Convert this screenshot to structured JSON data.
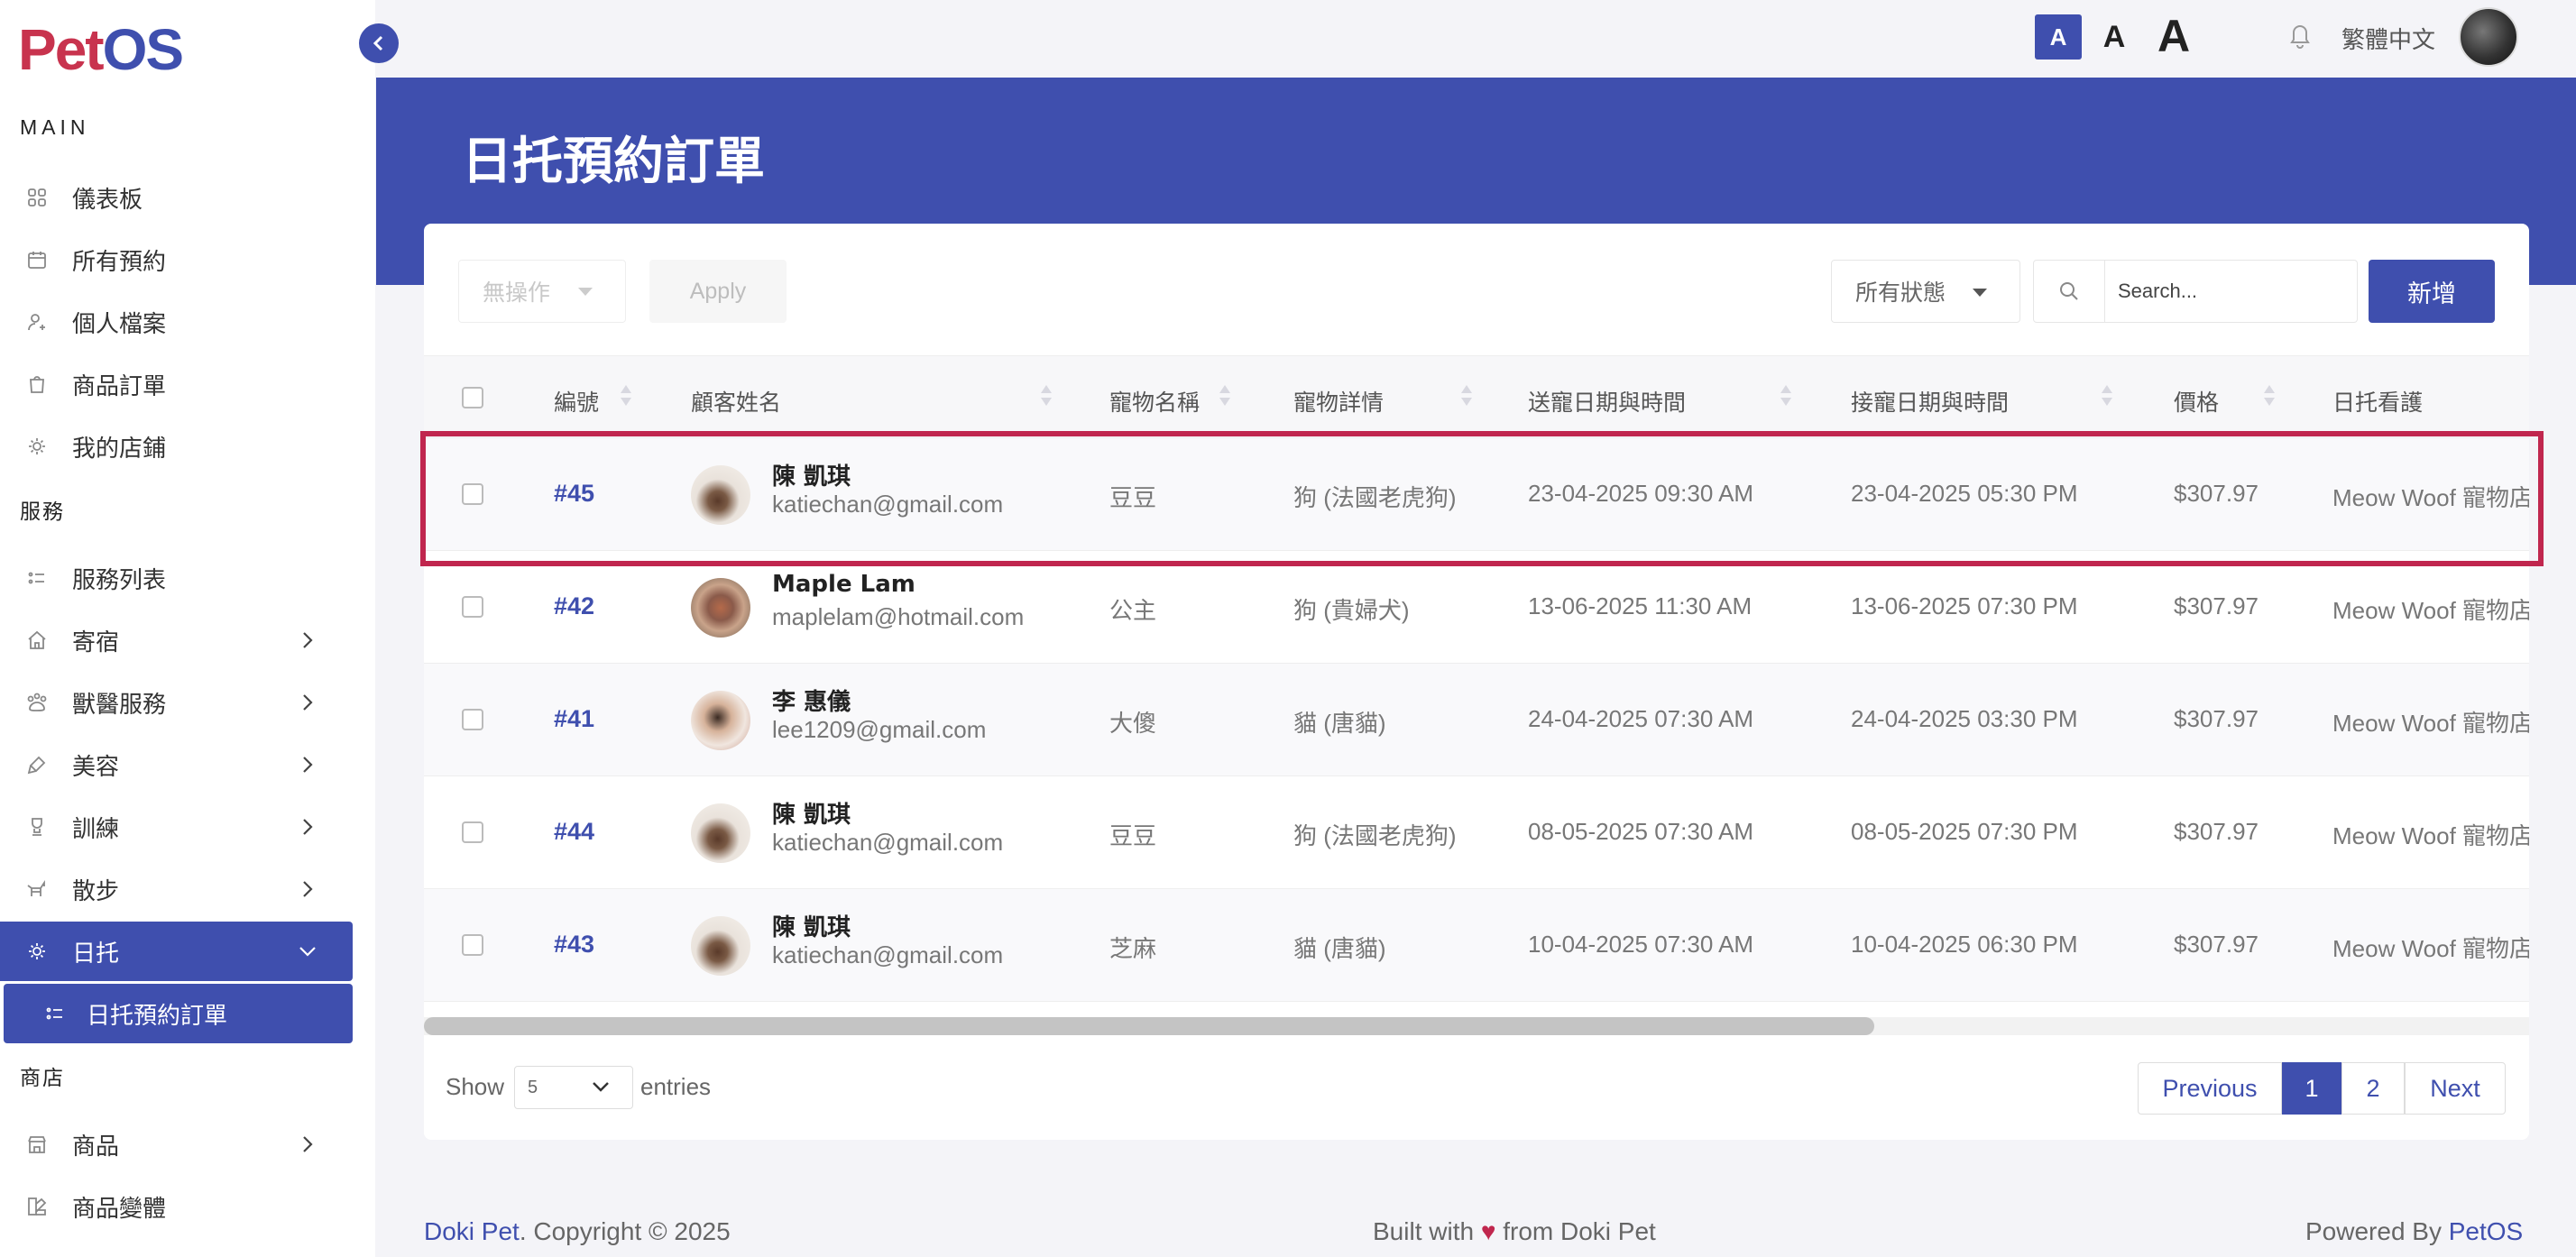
{
  "app": {
    "logo_part1": "Pet",
    "logo_part2": "OS"
  },
  "topbar": {
    "font_small": "A",
    "font_medium": "A",
    "font_large": "A",
    "language": "繁體中文"
  },
  "sidebar": {
    "section_main": "MAIN",
    "main_items": [
      {
        "label": "儀表板",
        "icon": "dashboard-icon"
      },
      {
        "label": "所有預約",
        "icon": "calendar-icon"
      },
      {
        "label": "個人檔案",
        "icon": "user-icon"
      },
      {
        "label": "商品訂單",
        "icon": "shopping-bag-icon"
      },
      {
        "label": "我的店鋪",
        "icon": "store-icon"
      }
    ],
    "section_services": "服務",
    "service_items": [
      {
        "label": "服務列表",
        "icon": "list-icon"
      },
      {
        "label": "寄宿",
        "icon": "house-icon"
      },
      {
        "label": "獸醫服務",
        "icon": "vet-icon"
      },
      {
        "label": "美容",
        "icon": "brush-icon"
      },
      {
        "label": "訓練",
        "icon": "training-icon"
      },
      {
        "label": "散步",
        "icon": "walk-icon"
      },
      {
        "label": "日托",
        "icon": "daycare-icon"
      }
    ],
    "sub_item": "日托預約訂單",
    "section_shop": "商店",
    "shop_items": [
      {
        "label": "商品",
        "icon": "product-icon"
      },
      {
        "label": "商品變體",
        "icon": "variant-icon"
      }
    ]
  },
  "page": {
    "title": "日托預約訂單"
  },
  "toolbar": {
    "bulk_action": "無操作",
    "apply_label": "Apply",
    "status_filter": "所有狀態",
    "search_placeholder": "Search...",
    "add_label": "新增"
  },
  "table": {
    "headers": [
      "編號",
      "顧客姓名",
      "寵物名稱",
      "寵物詳情",
      "送寵日期與時間",
      "接寵日期與時間",
      "價格",
      "日托看護"
    ],
    "rows": [
      {
        "id": "#45",
        "name": "陳 凱琪",
        "email": "katiechan@gmail.com",
        "pet": "豆豆",
        "detail": "狗 (法國老虎狗)",
        "dropoff": "23-04-2025 09:30 AM",
        "pickup": "23-04-2025 05:30 PM",
        "price": "$307.97",
        "caretaker": "Meow Woof 寵物店"
      },
      {
        "id": "#42",
        "name": "Maple Lam",
        "email": "maplelam@hotmail.com",
        "pet": "公主",
        "detail": "狗 (貴婦犬)",
        "dropoff": "13-06-2025 11:30 AM",
        "pickup": "13-06-2025 07:30 PM",
        "price": "$307.97",
        "caretaker": "Meow Woof 寵物店"
      },
      {
        "id": "#41",
        "name": "李 惠儀",
        "email": "lee1209@gmail.com",
        "pet": "大傻",
        "detail": "貓 (唐貓)",
        "dropoff": "24-04-2025 07:30 AM",
        "pickup": "24-04-2025 03:30 PM",
        "price": "$307.97",
        "caretaker": "Meow Woof 寵物店"
      },
      {
        "id": "#44",
        "name": "陳 凱琪",
        "email": "katiechan@gmail.com",
        "pet": "豆豆",
        "detail": "狗 (法國老虎狗)",
        "dropoff": "08-05-2025 07:30 AM",
        "pickup": "08-05-2025 07:30 PM",
        "price": "$307.97",
        "caretaker": "Meow Woof 寵物店"
      },
      {
        "id": "#43",
        "name": "陳 凱琪",
        "email": "katiechan@gmail.com",
        "pet": "芝麻",
        "detail": "貓 (唐貓)",
        "dropoff": "10-04-2025 07:30 AM",
        "pickup": "10-04-2025 06:30 PM",
        "price": "$307.97",
        "caretaker": "Meow Woof 寵物店"
      }
    ]
  },
  "pagination": {
    "show_label": "Show",
    "entries_value": "5",
    "entries_label": "entries",
    "previous": "Previous",
    "page1": "1",
    "page2": "2",
    "next": "Next"
  },
  "footer": {
    "brand": "Doki Pet",
    "copyright": ". Copyright © 2025",
    "built_prefix": "Built with ",
    "heart": "♥",
    "built_suffix": " from Doki Pet",
    "powered_prefix": "Powered By ",
    "powered_brand": "PetOS"
  },
  "colors": {
    "primary": "#3f4fae",
    "logo_red": "#c8334e",
    "highlight": "#c0264e"
  }
}
